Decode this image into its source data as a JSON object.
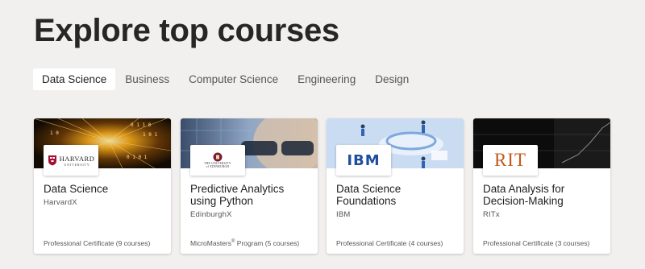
{
  "heading": "Explore top courses",
  "tabs": [
    {
      "label": "Data Science",
      "active": true
    },
    {
      "label": "Business",
      "active": false
    },
    {
      "label": "Computer Science",
      "active": false
    },
    {
      "label": "Engineering",
      "active": false
    },
    {
      "label": "Design",
      "active": false
    }
  ],
  "cards": [
    {
      "title": "Data Science",
      "org": "HarvardX",
      "type": "Professional Certificate (9 courses)",
      "logo": {
        "name": "harvard-logo",
        "line1": "HARVARD",
        "line2": "UNIVERSITY"
      }
    },
    {
      "title": "Predictive Analytics using Python",
      "org": "EdinburghX",
      "type_main": "MicroMasters",
      "type_sup": "®",
      "type_rest": " Program (5 courses)",
      "logo": {
        "name": "edinburgh-logo",
        "line1": "THE UNIVERSITY",
        "line2": "of EDINBURGH"
      }
    },
    {
      "title": "Data Science Foundations",
      "org": "IBM",
      "type": "Professional Certificate (4 courses)",
      "logo": {
        "name": "ibm-logo",
        "text": "IBM"
      }
    },
    {
      "title": "Data Analysis for Decision-Making",
      "org": "RITx",
      "type": "Professional Certificate (3 courses)",
      "logo": {
        "name": "rit-logo",
        "text": "RIT"
      }
    }
  ],
  "colors": {
    "background": "#f2f0ef",
    "card": "#ffffff",
    "ibm_blue": "#1f4e9e",
    "rit_orange": "#c45a1b",
    "harvard_crimson": "#a41034"
  }
}
